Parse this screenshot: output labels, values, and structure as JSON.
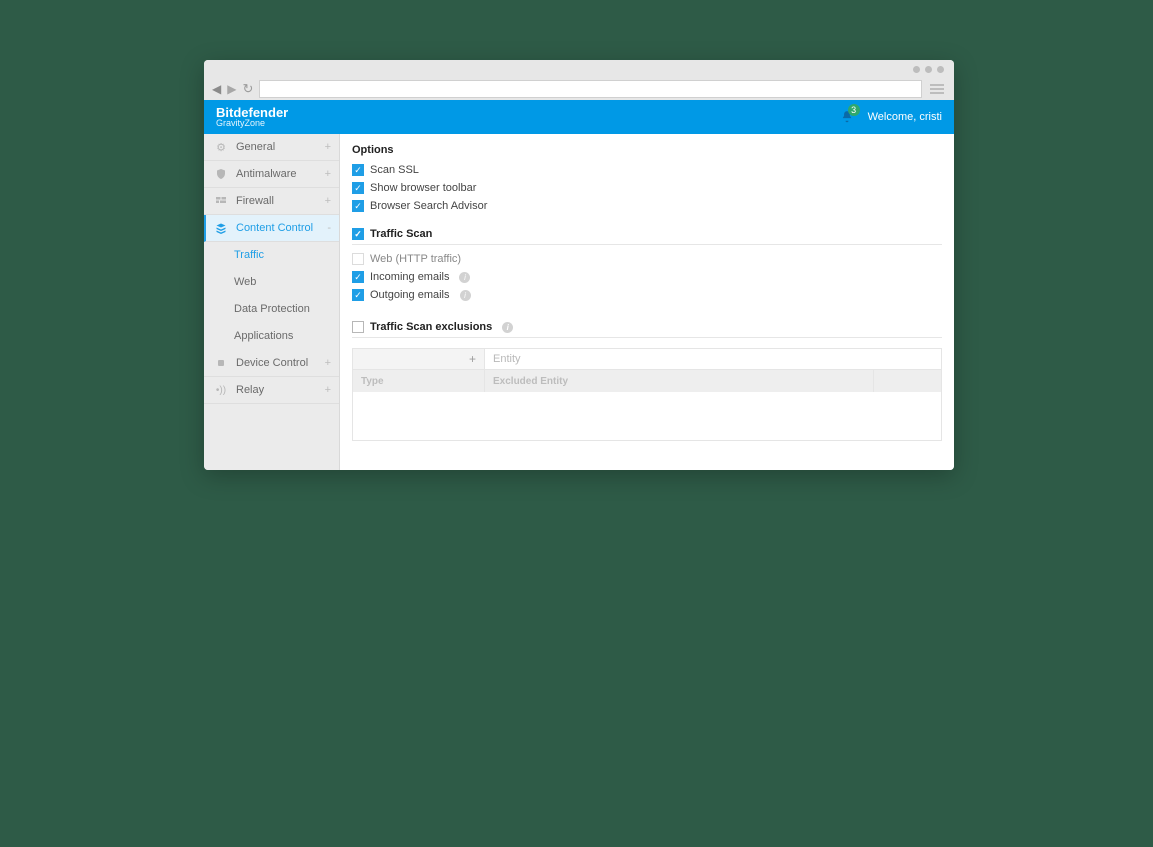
{
  "header": {
    "brand_name": "Bitdefender",
    "brand_sub": "GravityZone",
    "welcome": "Welcome, cristi",
    "notification_count": "3"
  },
  "sidebar": {
    "items": [
      {
        "label": "General",
        "expanded": false
      },
      {
        "label": "Antimalware",
        "expanded": false
      },
      {
        "label": "Firewall",
        "expanded": false
      },
      {
        "label": "Content Control",
        "expanded": true
      },
      {
        "label": "Device Control",
        "expanded": false
      },
      {
        "label": "Relay",
        "expanded": false
      }
    ],
    "content_control_sub": [
      {
        "label": "Traffic",
        "active": true
      },
      {
        "label": "Web",
        "active": false
      },
      {
        "label": "Data Protection",
        "active": false
      },
      {
        "label": "Applications",
        "active": false
      }
    ]
  },
  "main": {
    "options_title": "Options",
    "options": [
      {
        "label": "Scan SSL",
        "checked": true
      },
      {
        "label": "Show browser toolbar",
        "checked": true
      },
      {
        "label": "Browser Search Advisor",
        "checked": true
      }
    ],
    "traffic_scan": {
      "title": "Traffic Scan",
      "enabled": true,
      "items": [
        {
          "label": "Web (HTTP traffic)",
          "checked": false,
          "info": false
        },
        {
          "label": "Incoming emails",
          "checked": true,
          "info": true
        },
        {
          "label": "Outgoing emails",
          "checked": true,
          "info": true
        }
      ]
    },
    "exclusions": {
      "title": "Traffic Scan exclusions",
      "enabled": false,
      "entity_placeholder": "Entity",
      "columns": {
        "type": "Type",
        "entity": "Excluded Entity"
      }
    }
  }
}
